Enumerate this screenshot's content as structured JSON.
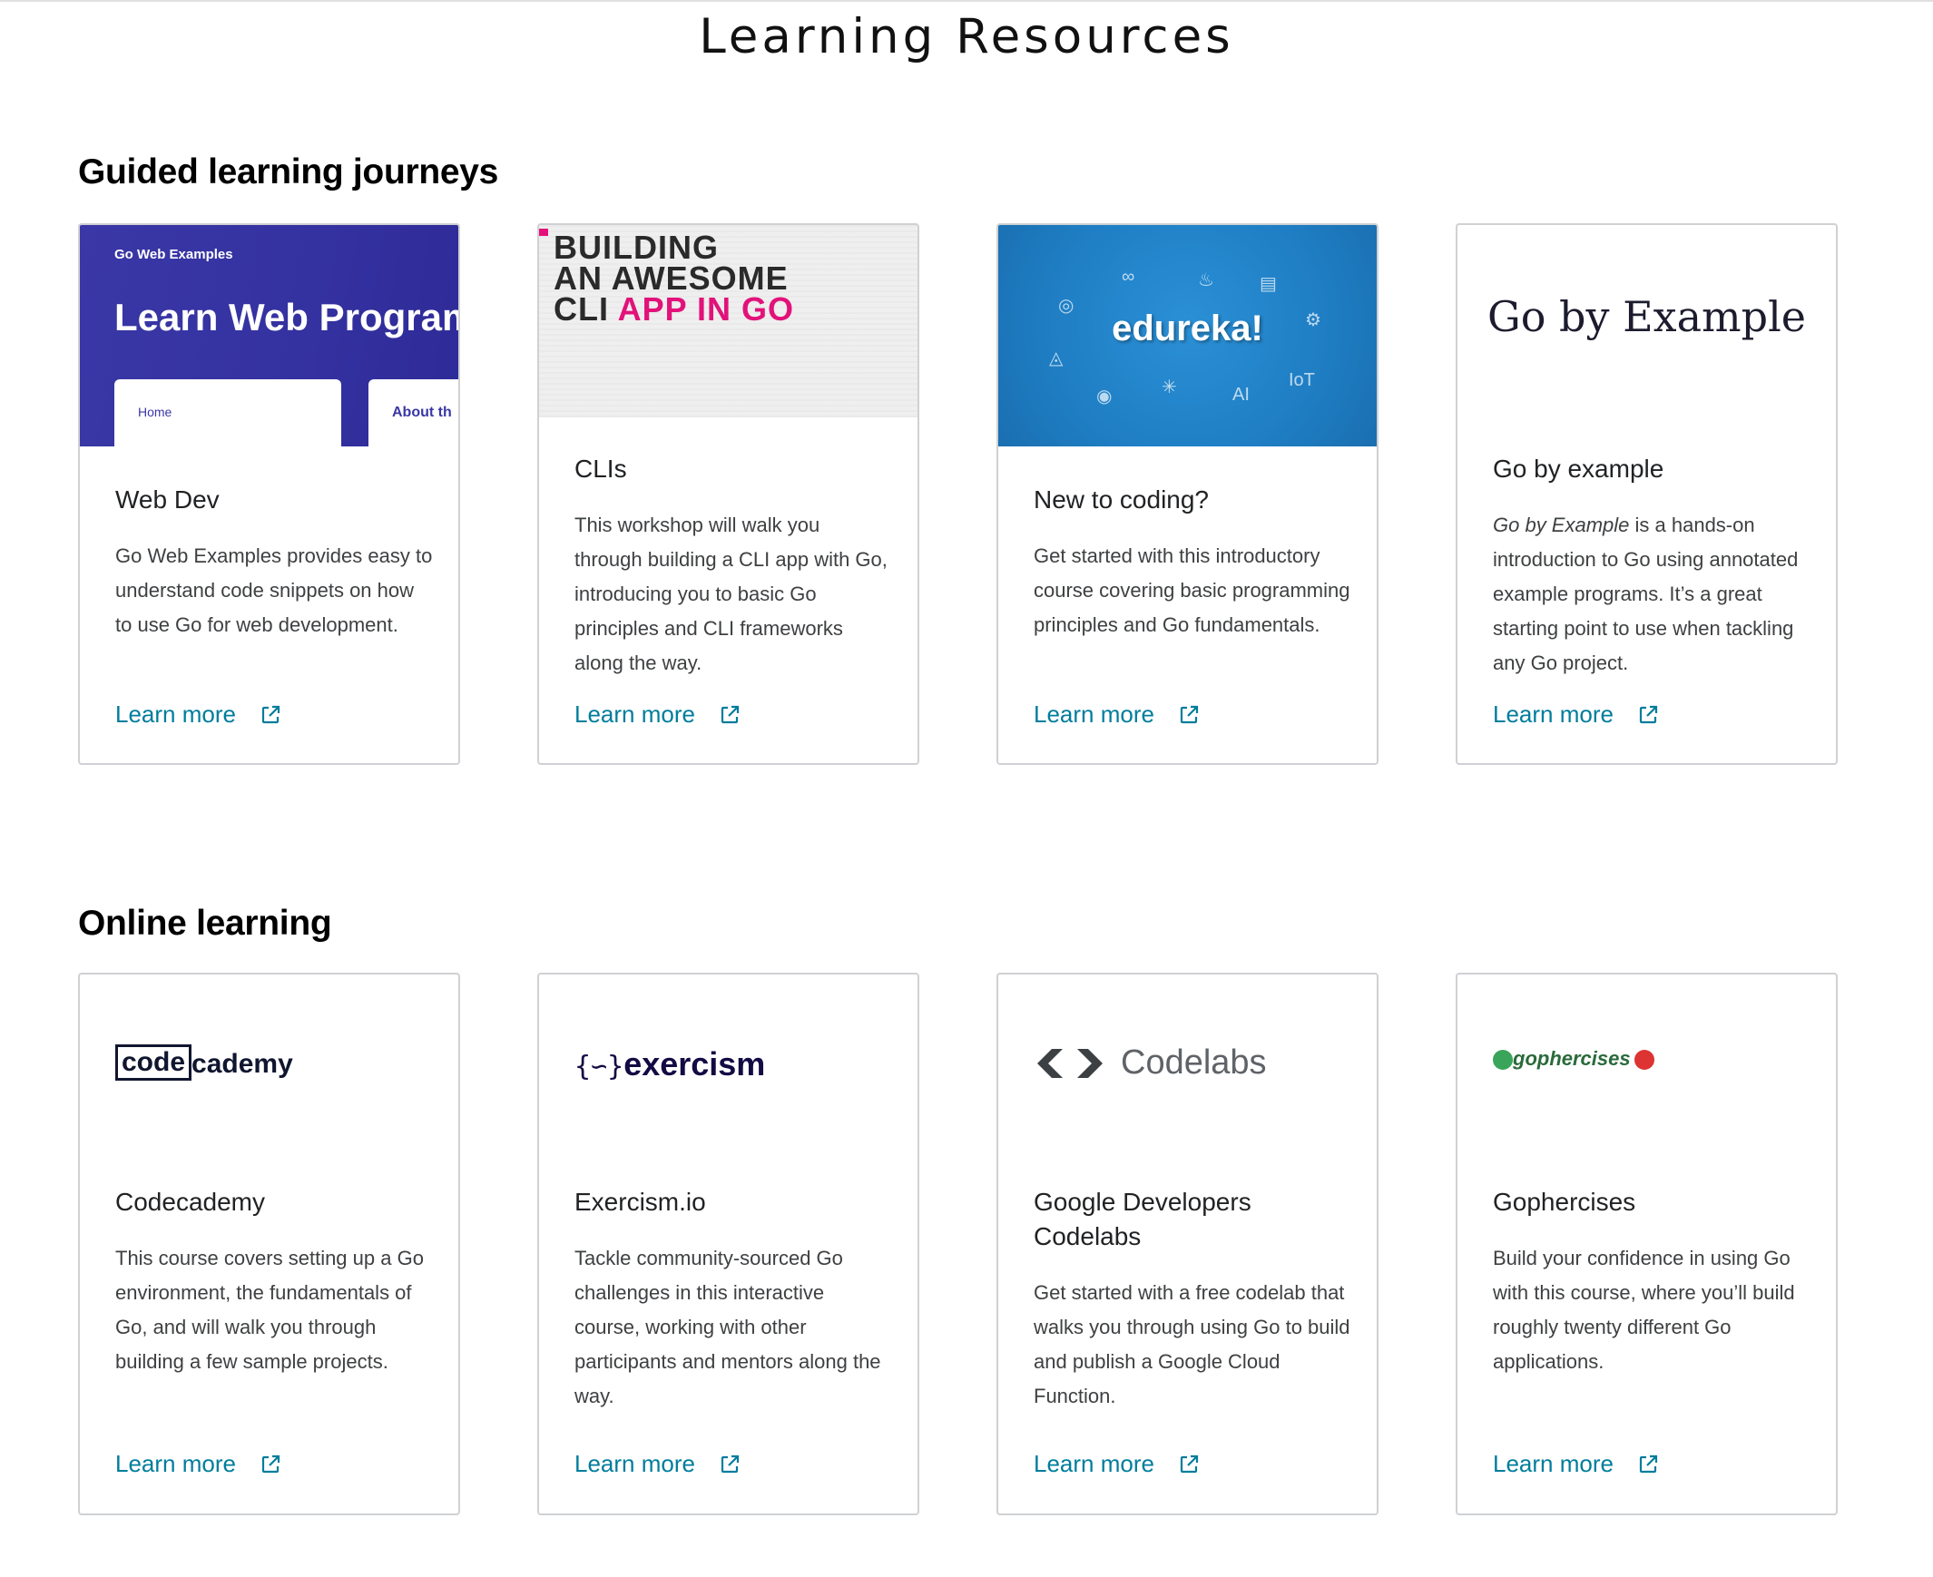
{
  "page_title": "Learning Resources",
  "sections": [
    {
      "heading": "Guided learning journeys",
      "cards": [
        {
          "title": "Web Dev",
          "description": "Go Web Examples provides easy to understand code snippets on how to use Go for web development.",
          "link": "Learn more",
          "thumb": {
            "small": "Go Web Examples",
            "big": "Learn Web Program",
            "panel1": "Home",
            "panel2": "About th"
          }
        },
        {
          "title": "CLIs",
          "description": "This workshop will walk you through building a CLI app with Go, introducing you to basic Go principles and CLI frameworks along the way.",
          "link": "Learn more",
          "thumb": {
            "line1": "BUILDING",
            "line2": "AN AWESOME",
            "line3a": "CLI ",
            "line3b": "APP IN GO"
          }
        },
        {
          "title": "New to coding?",
          "description": "Get started with this introductory course covering basic programming principles and Go fundamentals.",
          "link": "Learn more",
          "thumb": {
            "logo": "edureka!"
          }
        },
        {
          "title": "Go by example",
          "description_em": "Go by Example",
          "description": " is a hands-on introduction to Go using annotated example programs. It’s a great starting point to use when tackling any Go project.",
          "link": "Learn more",
          "thumb": {
            "logo": "Go by Example"
          }
        }
      ]
    },
    {
      "heading": "Online learning",
      "cards": [
        {
          "title": "Codecademy",
          "description": "This course covers setting up a Go environment, the fundamentals of Go, and will walk you through building a few sample projects.",
          "link": "Learn more",
          "logo": {
            "box": "code",
            "rest": "cademy"
          }
        },
        {
          "title": "Exercism.io",
          "description": "Tackle community-sourced Go challenges in this interactive course, working with other participants and mentors along the way.",
          "link": "Learn more",
          "logo": {
            "glyph": "{∽}",
            "name": "exercism"
          }
        },
        {
          "title": "Google Developers Codelabs",
          "description": "Get started with a free codelab that walks you through using Go to build and publish a Google Cloud Function.",
          "link": "Learn more",
          "logo": {
            "name": "Codelabs"
          }
        },
        {
          "title": "Gophercises",
          "description": "Build your confidence in using Go with this course, where you’ll build roughly twenty different Go applications.",
          "link": "Learn more",
          "logo": {
            "name": "gophercises"
          }
        }
      ]
    }
  ],
  "colors": {
    "link": "#007d9c",
    "card_border": "#cfd1d4",
    "webdev_bg": "#3431a0",
    "cli_pink": "#e2127a",
    "edureka_bg": "#1f7ec4"
  },
  "icons": [
    "external-link-icon",
    "codelabs-chevrons-icon"
  ]
}
